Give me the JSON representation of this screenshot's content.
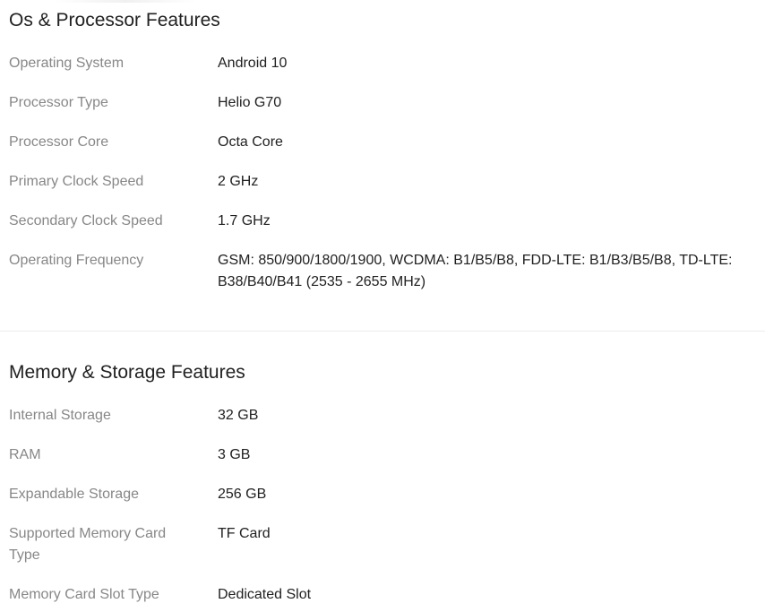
{
  "sections": [
    {
      "title": "Os & Processor Features",
      "rows": [
        {
          "label": "Operating System",
          "value": "Android 10"
        },
        {
          "label": "Processor Type",
          "value": "Helio G70"
        },
        {
          "label": "Processor Core",
          "value": "Octa Core"
        },
        {
          "label": "Primary Clock Speed",
          "value": "2 GHz"
        },
        {
          "label": "Secondary Clock Speed",
          "value": "1.7 GHz"
        },
        {
          "label": "Operating Frequency",
          "value": "GSM: 850/900/1800/1900, WCDMA: B1/B5/B8, FDD-LTE: B1/B3/B5/B8, TD-LTE: B38/B40/B41 (2535 - 2655 MHz)"
        }
      ]
    },
    {
      "title": "Memory & Storage Features",
      "rows": [
        {
          "label": "Internal Storage",
          "value": "32 GB"
        },
        {
          "label": "RAM",
          "value": "3 GB"
        },
        {
          "label": "Expandable Storage",
          "value": "256 GB"
        },
        {
          "label": "Supported Memory Card Type",
          "value": "TF Card"
        },
        {
          "label": "Memory Card Slot Type",
          "value": "Dedicated Slot"
        }
      ]
    }
  ]
}
